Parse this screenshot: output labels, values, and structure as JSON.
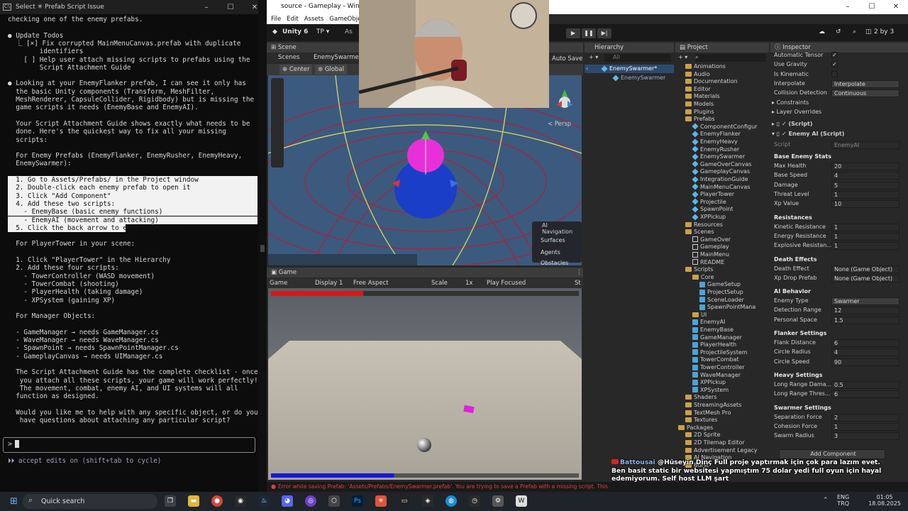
{
  "terminal": {
    "title": "Select ✳ Prefab Script Issue",
    "window_controls": [
      "–",
      "☐",
      "✕"
    ],
    "lines": [
      {
        "text": "checking one of the enemy prefabs.",
        "hl": false
      },
      {
        "text": "",
        "hl": false
      },
      {
        "text": "● Update Todos",
        "hl": false
      },
      {
        "text": "  ⎿ [×] Fix corrupted MainMenuCanvas.prefab with duplicate",
        "hl": false
      },
      {
        "text": "        identifiers",
        "hl": false
      },
      {
        "text": "    [ ] Help user attach missing scripts to prefabs using the",
        "hl": false
      },
      {
        "text": "        Script Attachment Guide",
        "hl": false
      },
      {
        "text": "",
        "hl": false
      },
      {
        "text": "● Looking at your EnemyFlanker prefab, I can see it only has",
        "hl": false
      },
      {
        "text": "  the basic Unity components (Transform, MeshFilter,",
        "hl": false
      },
      {
        "text": "  MeshRenderer, CapsuleCollider, Rigidbody) but is missing the",
        "hl": false
      },
      {
        "text": "  game scripts it needs (EnemyBase and EnemyAI).",
        "hl": false
      },
      {
        "text": "",
        "hl": false
      },
      {
        "text": "  Your Script Attachment Guide shows exactly what needs to be",
        "hl": false
      },
      {
        "text": "  done. Here's the quickest way to fix all your missing",
        "hl": false
      },
      {
        "text": "  scripts:",
        "hl": false
      },
      {
        "text": "",
        "hl": false
      },
      {
        "text": "  For Enemy Prefabs (EnemyFlanker, EnemyRusher, EnemyHeavy,",
        "hl": false
      },
      {
        "text": "  EnemySwarmer):",
        "hl": false
      },
      {
        "text": "",
        "hl": false
      },
      {
        "text": "  1. Go to Assets/Prefabs/ in the Project window",
        "hl": true
      },
      {
        "text": "  2. Double-click each enemy prefab to open it",
        "hl": true
      },
      {
        "text": "  3. Click \"Add Component\"",
        "hl": true
      },
      {
        "text": "  4. Add these two scripts:",
        "hl": true
      },
      {
        "text": "    - EnemyBase (basic enemy functions)",
        "hl": true
      },
      {
        "text": "    - EnemyAI (movement and attacking)",
        "hl": true
      },
      {
        "text": "  5. Click the back arrow to exit prefab mode",
        "hl": "partial"
      },
      {
        "text": "",
        "hl": false
      },
      {
        "text": "  For PlayerTower in your scene:",
        "hl": false
      },
      {
        "text": "",
        "hl": false
      },
      {
        "text": "  1. Click \"PlayerTower\" in the Hierarchy",
        "hl": false
      },
      {
        "text": "  2. Add these four scripts:",
        "hl": false
      },
      {
        "text": "    - TowerController (WASD movement)",
        "hl": false
      },
      {
        "text": "    - TowerCombat (shooting)",
        "hl": false
      },
      {
        "text": "    - PlayerHealth (taking damage)",
        "hl": false
      },
      {
        "text": "    - XPSystem (gaining XP)",
        "hl": false
      },
      {
        "text": "",
        "hl": false
      },
      {
        "text": "  For Manager Objects:",
        "hl": false
      },
      {
        "text": "",
        "hl": false
      },
      {
        "text": "  - GameManager → needs GameManager.cs",
        "hl": false
      },
      {
        "text": "  - WaveManager → needs WaveManager.cs",
        "hl": false
      },
      {
        "text": "  - SpawnPoint → needs SpawnPointManager.cs",
        "hl": false
      },
      {
        "text": "  - GameplayCanvas → needs UIManager.cs",
        "hl": false
      },
      {
        "text": "",
        "hl": false
      },
      {
        "text": "  The Script Attachment Guide has the complete checklist - once",
        "hl": false
      },
      {
        "text": "   you attach all these scripts, your game will work perfectly!",
        "hl": false
      },
      {
        "text": "   The movement, combat, enemy AI, and UI systems will all",
        "hl": false
      },
      {
        "text": "  function as designed.",
        "hl": false
      },
      {
        "text": "",
        "hl": false
      },
      {
        "text": "  Would you like me to help with any specific object, or do you",
        "hl": false
      },
      {
        "text": "   have questions about attaching any particular script?",
        "hl": false
      }
    ],
    "prompt": ">",
    "status": "⏵⏵ accept edits on (shift+tab to cycle)"
  },
  "unity": {
    "title": "source - Gameplay - Windows,",
    "menu": [
      "File",
      "Edit",
      "Assets",
      "GameObject"
    ],
    "version": "Unity 6",
    "tp": "TP ▾",
    "as_label": "As",
    "auto_save": "Auto Save",
    "layout": "2 by 3",
    "scene_tab": "Scene",
    "scenes_crumb": "Scenes",
    "prefab_crumb": "EnemySwarmer",
    "center": "Center",
    "global": "Global",
    "persp": "< Persp",
    "ai_nav": {
      "title": "AI Navigation",
      "items": [
        "Surfaces",
        "Agents",
        "Obstacles"
      ]
    },
    "game": {
      "tab": "Game",
      "display_mode": "Game",
      "display": "Display 1",
      "aspect": "Free Aspect",
      "scale": "Scale",
      "scale_val": "1x",
      "play_focused": "Play Focused",
      "stats": "St",
      "health_pct": 30,
      "xp_pct": 40
    },
    "hierarchy": {
      "tab": "Hierarchy",
      "search_placeholder": "All",
      "root": "EnemySwarmer*",
      "child": "EnemySwarmer"
    },
    "project": {
      "tab": "Project",
      "items": [
        {
          "name": "Animations",
          "kind": "folder",
          "indent": 1
        },
        {
          "name": "Audio",
          "kind": "folder",
          "indent": 1
        },
        {
          "name": "Documentation",
          "kind": "folder",
          "indent": 1
        },
        {
          "name": "Editor",
          "kind": "folder",
          "indent": 1
        },
        {
          "name": "Materials",
          "kind": "folder",
          "indent": 1
        },
        {
          "name": "Models",
          "kind": "folder",
          "indent": 1
        },
        {
          "name": "Plugins",
          "kind": "folder",
          "indent": 1
        },
        {
          "name": "Prefabs",
          "kind": "folder",
          "indent": 1
        },
        {
          "name": "ComponentConfigur",
          "kind": "prefab",
          "indent": 2
        },
        {
          "name": "EnemyFlanker",
          "kind": "prefab",
          "indent": 2
        },
        {
          "name": "EnemyHeavy",
          "kind": "prefab",
          "indent": 2
        },
        {
          "name": "EnemyRusher",
          "kind": "prefab",
          "indent": 2
        },
        {
          "name": "EnemySwarmer",
          "kind": "prefab",
          "indent": 2
        },
        {
          "name": "GameOverCanvas",
          "kind": "prefab",
          "indent": 2
        },
        {
          "name": "GameplayCanvas",
          "kind": "prefab",
          "indent": 2
        },
        {
          "name": "IntegrationGuide",
          "kind": "prefab",
          "indent": 2
        },
        {
          "name": "MainMenuCanvas",
          "kind": "prefab",
          "indent": 2
        },
        {
          "name": "PlayerTower",
          "kind": "prefab",
          "indent": 2
        },
        {
          "name": "Projectile",
          "kind": "prefab",
          "indent": 2
        },
        {
          "name": "SpawnPoint",
          "kind": "prefab",
          "indent": 2
        },
        {
          "name": "XPPickup",
          "kind": "prefab",
          "indent": 2
        },
        {
          "name": "Resources",
          "kind": "folder",
          "indent": 1
        },
        {
          "name": "Scenes",
          "kind": "folder",
          "indent": 1
        },
        {
          "name": "GameOver",
          "kind": "scene",
          "indent": 2
        },
        {
          "name": "Gameplay",
          "kind": "scene",
          "indent": 2
        },
        {
          "name": "MainMenu",
          "kind": "scene",
          "indent": 2
        },
        {
          "name": "README",
          "kind": "scene",
          "indent": 2
        },
        {
          "name": "Scripts",
          "kind": "folder",
          "indent": 1
        },
        {
          "name": "Core",
          "kind": "folder",
          "indent": 2
        },
        {
          "name": "GameSetup",
          "kind": "script",
          "indent": 3
        },
        {
          "name": "ProjectSetup",
          "kind": "script",
          "indent": 3
        },
        {
          "name": "SceneLoader",
          "kind": "script",
          "indent": 3
        },
        {
          "name": "SpawnPointMana",
          "kind": "script",
          "indent": 3
        },
        {
          "name": "UI",
          "kind": "folder",
          "indent": 2
        },
        {
          "name": "EnemyAI",
          "kind": "script",
          "indent": 2
        },
        {
          "name": "EnemyBase",
          "kind": "script",
          "indent": 2
        },
        {
          "name": "GameManager",
          "kind": "script",
          "indent": 2
        },
        {
          "name": "PlayerHealth",
          "kind": "script",
          "indent": 2
        },
        {
          "name": "ProjectileSystem",
          "kind": "script",
          "indent": 2
        },
        {
          "name": "TowerCombat",
          "kind": "script",
          "indent": 2
        },
        {
          "name": "TowerController",
          "kind": "script",
          "indent": 2
        },
        {
          "name": "WaveManager",
          "kind": "script",
          "indent": 2
        },
        {
          "name": "XPPickup",
          "kind": "script",
          "indent": 2
        },
        {
          "name": "XPSystem",
          "kind": "script",
          "indent": 2
        },
        {
          "name": "Shaders",
          "kind": "folder",
          "indent": 1
        },
        {
          "name": "StreamingAssets",
          "kind": "folder",
          "indent": 1
        },
        {
          "name": "TextMesh Pro",
          "kind": "folder",
          "indent": 1
        },
        {
          "name": "Textures",
          "kind": "folder",
          "indent": 1
        },
        {
          "name": "Packages",
          "kind": "folder",
          "indent": 0
        },
        {
          "name": "2D Sprite",
          "kind": "folder",
          "indent": 1
        },
        {
          "name": "2D Tilemap Editor",
          "kind": "folder",
          "indent": 1
        },
        {
          "name": "Advertisement Legacy",
          "kind": "folder",
          "indent": 1
        },
        {
          "name": "AI Navigation",
          "kind": "folder",
          "indent": 1
        },
        {
          "name": "Burst",
          "kind": "folder",
          "indent": 1
        }
      ]
    },
    "inspector": {
      "tab": "Inspector",
      "top_rows": [
        {
          "label": "Automatic Tensor",
          "check": "✓"
        },
        {
          "label": "Use Gravity",
          "check": "✓"
        },
        {
          "label": "Is Kinematic",
          "check": ""
        },
        {
          "label": "Interpolate",
          "value": "Interpolate"
        },
        {
          "label": "Collision Detection",
          "value": "Continuous"
        }
      ],
      "foldouts": [
        "Constraints",
        "Layer Overrides"
      ],
      "missing_script": "(Script)",
      "component": "Enemy AI (Script)",
      "script_label": "Script",
      "script_value": "EnemyAI",
      "sections": [
        {
          "title": "Base Enemy Stats",
          "rows": [
            [
              "Max Health",
              "20"
            ],
            [
              "Base Speed",
              "4"
            ],
            [
              "Damage",
              "5"
            ],
            [
              "Threat Level",
              "1"
            ],
            [
              "Xp Value",
              "10"
            ]
          ]
        },
        {
          "title": "Resistances",
          "rows": [
            [
              "Kinetic Resistance",
              "1"
            ],
            [
              "Energy Resistance",
              "1"
            ],
            [
              "Explosive Resistan...",
              "1"
            ]
          ]
        },
        {
          "title": "Death Effects",
          "rows": [
            [
              "Death Effect",
              "None (Game Object)"
            ],
            [
              "Xp Drop Prefab",
              "None (Game Object)"
            ]
          ]
        },
        {
          "title": "AI Behavior",
          "rows": [
            [
              "Enemy Type",
              "Swarmer"
            ],
            [
              "Detection Range",
              "12"
            ],
            [
              "Personal Space",
              "1.5"
            ]
          ]
        },
        {
          "title": "Flanker Settings",
          "rows": [
            [
              "Flank Distance",
              "6"
            ],
            [
              "Circle Radius",
              "4"
            ],
            [
              "Circle Speed",
              "90"
            ]
          ]
        },
        {
          "title": "Heavy Settings",
          "rows": [
            [
              "Long Range Dama...",
              "0.5"
            ],
            [
              "Long Range Thres...",
              "6"
            ]
          ]
        },
        {
          "title": "Swarmer Settings",
          "rows": [
            [
              "Separation Force",
              "2"
            ],
            [
              "Cohesion Force",
              "1"
            ],
            [
              "Swarm Radius",
              "3"
            ]
          ]
        }
      ],
      "add_component": "Add Component"
    },
    "status_error": "Error while saving Prefab: 'Assets/Prefabs/EnemySwarmer.prefab'. You are trying to save a Prefab with a missing script. This"
  },
  "chat": {
    "user": "Battousai",
    "message": "@Hüseyin Dinç Full proje yaptırmak için çok para lazım evet. Ben basit static bir websitesi yapmıştım 75 dolar yedi full oyun için hayal edemiyorum. Self host LLM şart"
  },
  "taskbar": {
    "search": "Quick search",
    "lang": "ENG",
    "region": "TRQ",
    "time": "01:05",
    "date": "18.08.2025"
  },
  "colors": {
    "accent": "#2d5a8c",
    "error": "#e04040",
    "health": "#d81818",
    "xp": "#1818d8"
  }
}
